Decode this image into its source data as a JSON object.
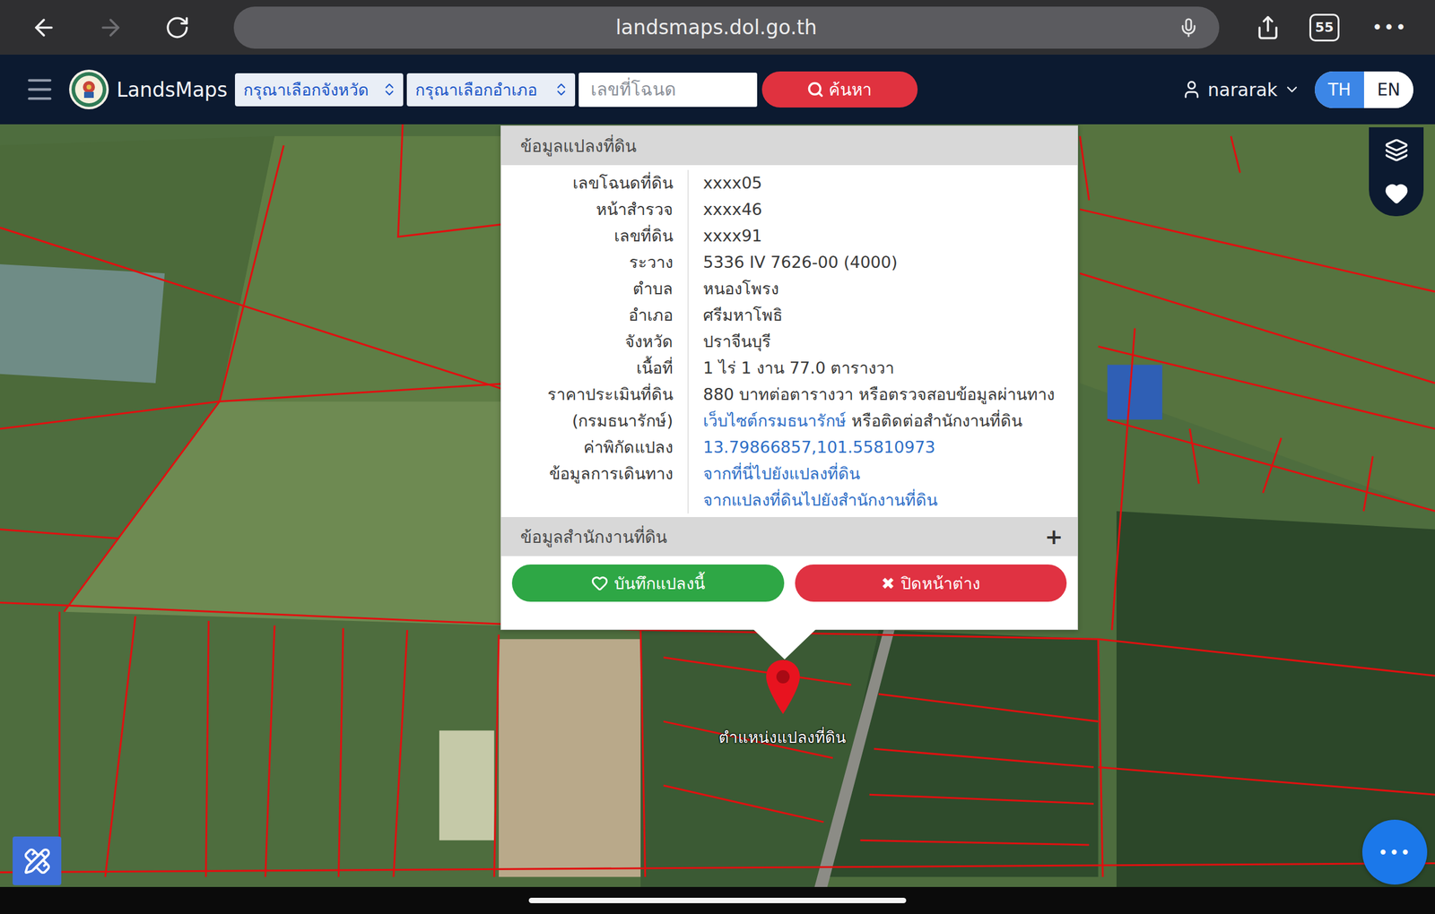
{
  "browser": {
    "url": "landsmaps.dol.go.th",
    "tab_count": "55",
    "more": "•••",
    "back_enabled": true,
    "forward_enabled": false
  },
  "nav": {
    "app_name": "LandsMaps",
    "selects": [
      "กรุณาเลือกจังหวัด",
      "กรุณาเลือกอำเภอ"
    ],
    "deed_input": {
      "placeholder": "เลขที่โฉนด"
    },
    "search_button": "ค้นหา",
    "user": "nararak",
    "languages": [
      {
        "label": "TH",
        "selected": true
      },
      {
        "label": "EN",
        "selected": false
      }
    ]
  },
  "popup": {
    "title": "ข้อมูลแปลงที่ดิน",
    "rows": [
      {
        "label": [
          "เลขโฉนดที่ดิน"
        ],
        "lines": [
          [
            {
              "text": "xxxx05",
              "link": false
            }
          ]
        ]
      },
      {
        "label": [
          "หน้าสำรวจ"
        ],
        "lines": [
          [
            {
              "text": "xxxx46",
              "link": false
            }
          ]
        ]
      },
      {
        "label": [
          "เลขที่ดิน"
        ],
        "lines": [
          [
            {
              "text": "xxxx91",
              "link": false
            }
          ]
        ]
      },
      {
        "label": [
          "ระวาง"
        ],
        "lines": [
          [
            {
              "text": "5336 IV 7626-00 (4000)",
              "link": false
            }
          ]
        ]
      },
      {
        "label": [
          "ตำบล"
        ],
        "lines": [
          [
            {
              "text": "หนองโพรง",
              "link": false
            }
          ]
        ]
      },
      {
        "label": [
          "อำเภอ"
        ],
        "lines": [
          [
            {
              "text": "ศรีมหาโพธิ",
              "link": false
            }
          ]
        ]
      },
      {
        "label": [
          "จังหวัด"
        ],
        "lines": [
          [
            {
              "text": "ปราจีนบุรี",
              "link": false
            }
          ]
        ]
      },
      {
        "label": [
          "เนื้อที่"
        ],
        "lines": [
          [
            {
              "text": "1 ไร่ 1 งาน 77.0 ตารางวา",
              "link": false
            }
          ]
        ]
      },
      {
        "label": [
          "ราคาประเมินที่ดิน",
          "(กรมธนารักษ์)"
        ],
        "lines": [
          [
            {
              "text": "880 บาทต่อตารางวา หรือตรวจสอบข้อมูลผ่านทาง",
              "link": false
            }
          ],
          [
            {
              "text": "เว็บไซต์กรมธนารักษ์",
              "link": true
            },
            {
              "text": " หรือติดต่อสำนักงานที่ดิน",
              "link": false
            }
          ]
        ]
      },
      {
        "label": [
          "ค่าพิกัดแปลง"
        ],
        "lines": [
          [
            {
              "text": "13.79866857,101.55810973",
              "link": true
            }
          ]
        ]
      },
      {
        "label": [
          "ข้อมูลการเดินทาง"
        ],
        "lines": [
          [
            {
              "text": "จากที่นี่ไปยังแปลงที่ดิน",
              "link": true
            }
          ],
          [
            {
              "text": "จากแปลงที่ดินไปยังสำนักงานที่ดิน",
              "link": true
            }
          ]
        ]
      }
    ],
    "section": {
      "title": "ข้อมูลสำนักงานที่ดิน",
      "toggle": "+",
      "expanded": false
    },
    "buttons": [
      {
        "label": "บันทึกแปลงนี้",
        "icon": "heart",
        "color": "#2ea745"
      },
      {
        "label": "ปิดหน้าต่าง",
        "icon": "✖",
        "color": "#e03242"
      }
    ]
  },
  "map": {
    "pin_label": "ตำแหน่งแปลงที่ดิน",
    "fab": "•••"
  }
}
